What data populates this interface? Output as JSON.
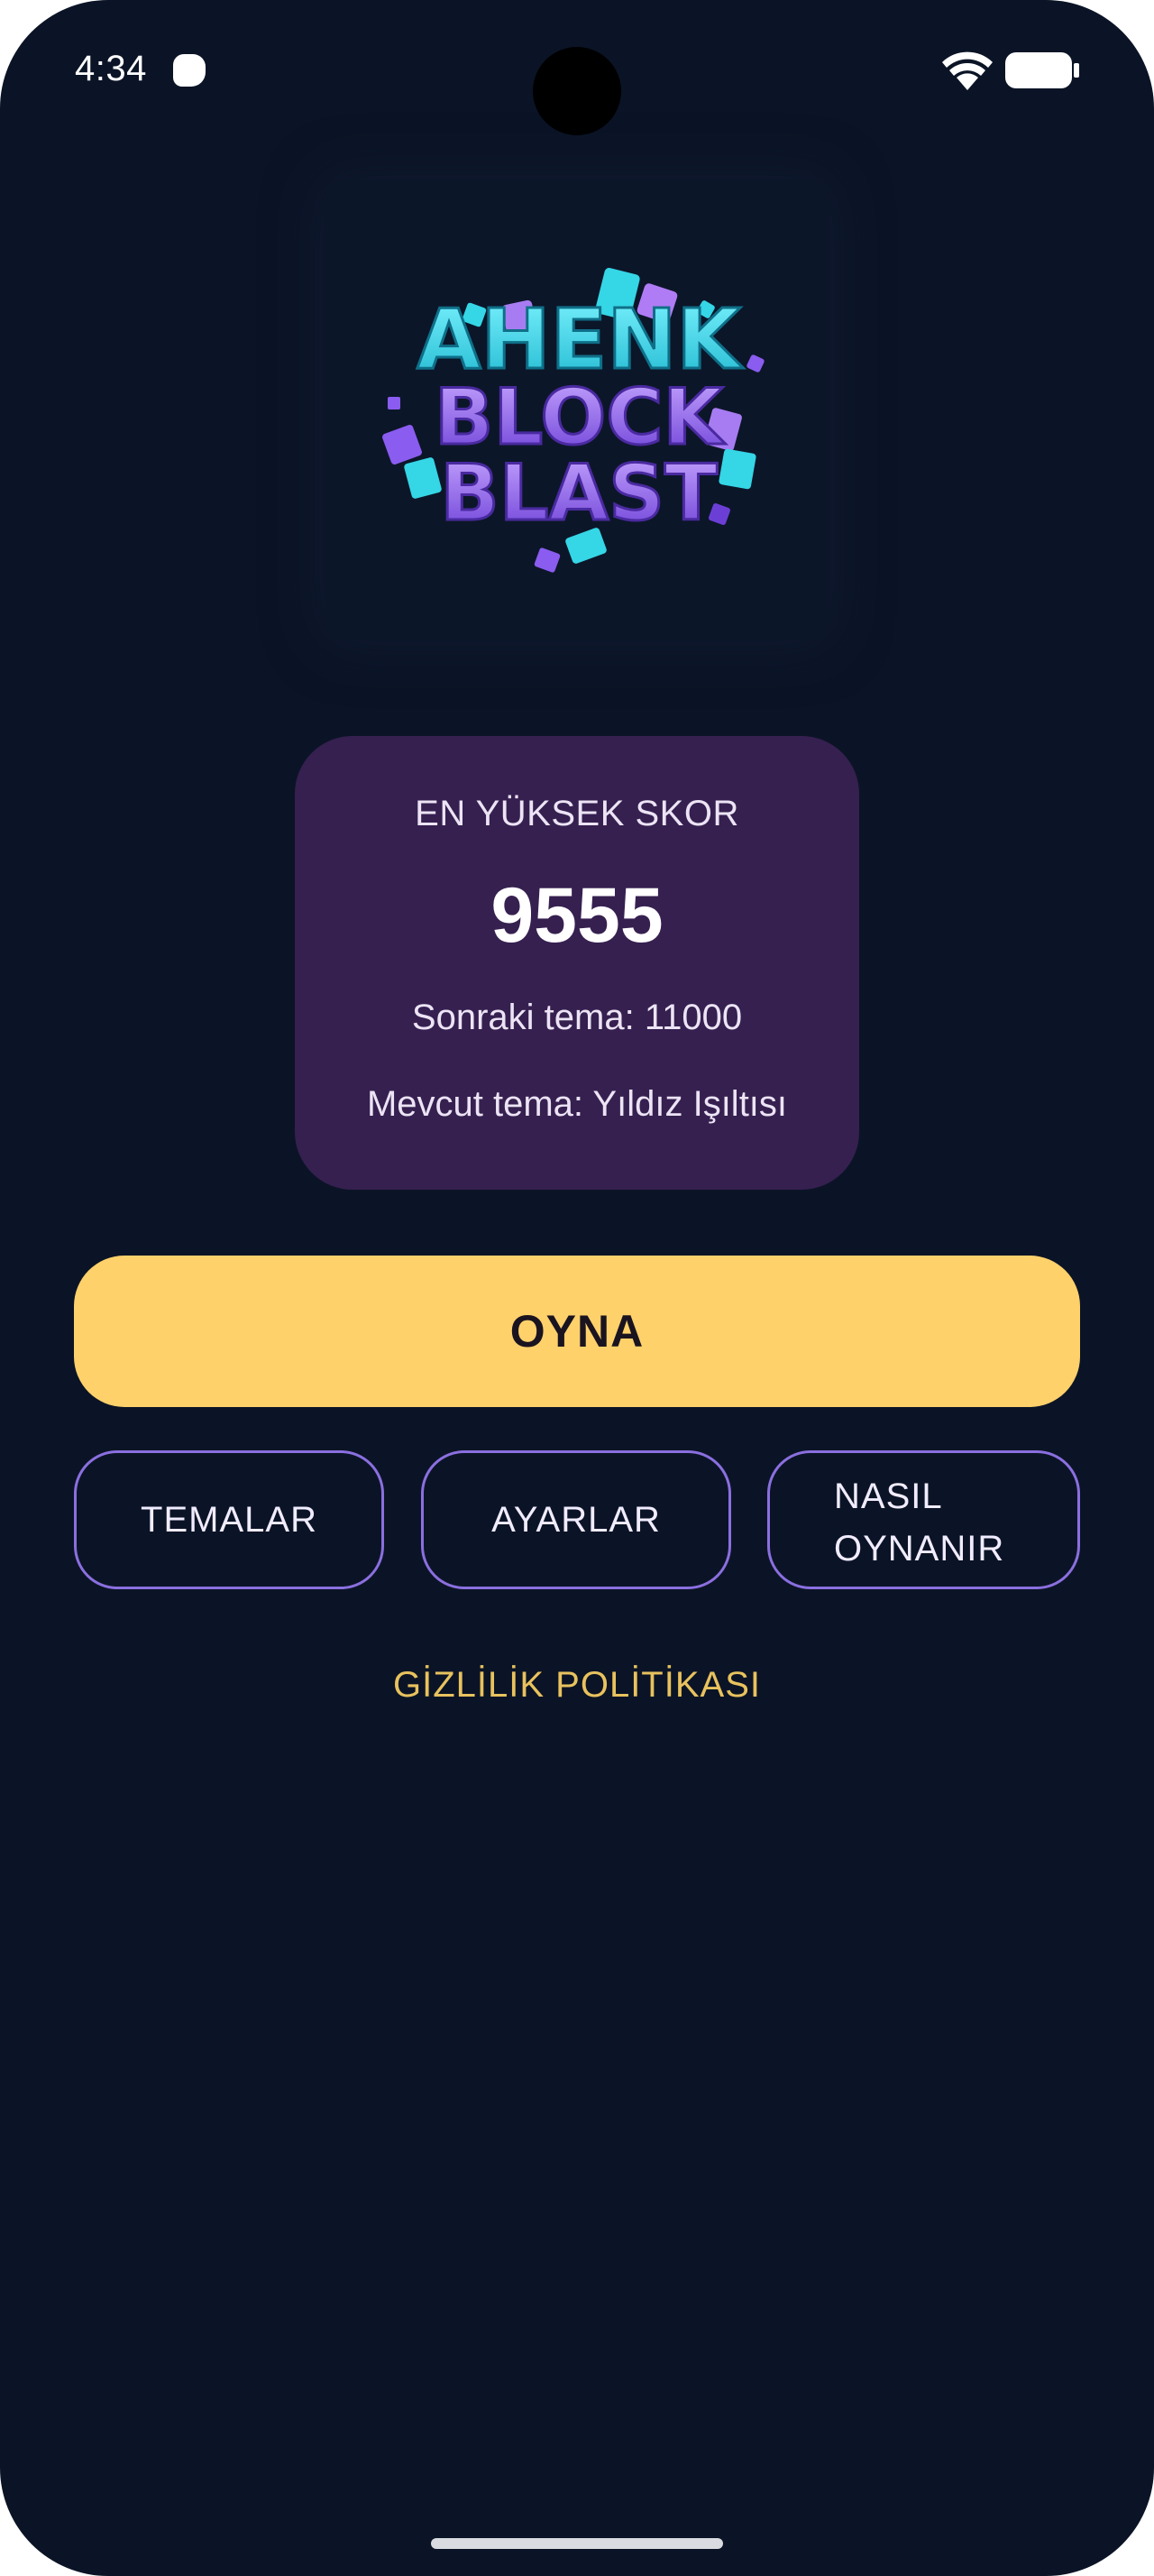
{
  "status_bar": {
    "time": "4:34",
    "icons": [
      "app-notification-icon",
      "wifi-icon",
      "battery-icon"
    ]
  },
  "logo": {
    "line1": "AHENK",
    "line2": "BLOCK",
    "line3": "BLAST"
  },
  "score_card": {
    "title": "EN YÜKSEK SKOR",
    "high_score": "9555",
    "next_theme": "Sonraki tema: 11000",
    "current_theme": "Mevcut tema: Yıldız Işıltısı"
  },
  "buttons": {
    "play": "OYNA",
    "themes": "TEMALAR",
    "settings": "AYARLAR",
    "how_to_play_line1": "NASIL",
    "how_to_play_line2": "OYNANIR"
  },
  "links": {
    "privacy": "GİZLİLİK POLİTİKASI"
  },
  "colors": {
    "background": "#0b1426",
    "card": "#362050",
    "play_button": "#ffd16b",
    "button_border": "#8b6fe0",
    "link": "#e8c25e",
    "logo_cyan": "#35d6e6",
    "logo_purple": "#8a5cf0"
  }
}
